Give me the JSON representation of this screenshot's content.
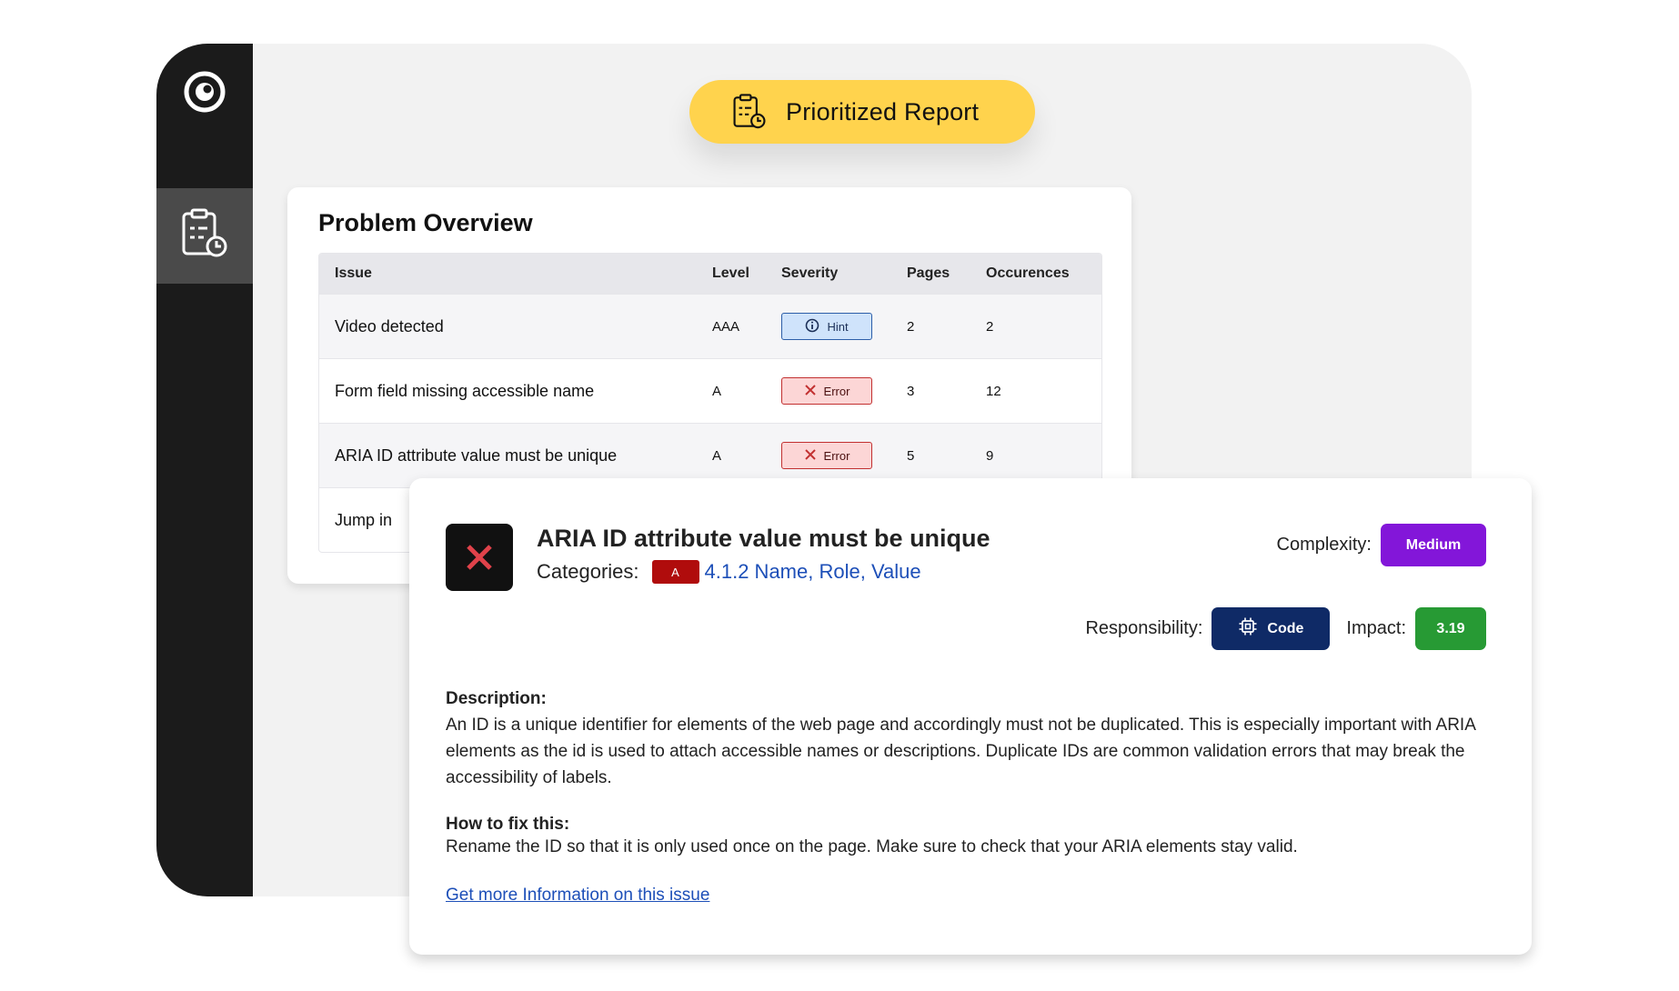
{
  "header": {
    "pill_label": "Prioritized Report"
  },
  "sidebar": {
    "items": [
      {
        "icon": "eye-logo-icon"
      },
      {
        "icon": "clipboard-clock-icon",
        "active": true
      }
    ]
  },
  "overview": {
    "title": "Problem Overview",
    "columns": {
      "issue": "Issue",
      "level": "Level",
      "severity": "Severity",
      "pages": "Pages",
      "occurrences": "Occurences"
    },
    "rows": [
      {
        "issue": "Video detected",
        "level": "AAA",
        "severity": "Hint",
        "pages": "2",
        "occurrences": "2"
      },
      {
        "issue": "Form field missing accessible name",
        "level": "A",
        "severity": "Error",
        "pages": "3",
        "occurrences": "12"
      },
      {
        "issue": "ARIA ID attribute value must be unique",
        "level": "A",
        "severity": "Error",
        "pages": "5",
        "occurrences": "9"
      },
      {
        "issue": "Jump in",
        "level": "",
        "severity": "",
        "pages": "",
        "occurrences": ""
      }
    ]
  },
  "detail": {
    "title": "ARIA ID attribute value must be unique",
    "categories_label": "Categories:",
    "level_badge": "A",
    "category_link": "4.1.2 Name, Role, Value",
    "complexity_label": "Complexity:",
    "complexity_value": "Medium",
    "responsibility_label": "Responsibility:",
    "responsibility_value": "Code",
    "impact_label": "Impact:",
    "impact_value": "3.19",
    "description_heading": "Description:",
    "description_text": "An ID is a unique identifier for elements of the web page and accordingly must not be duplicated. This is especially important with ARIA elements as the id is used to attach accessible names or descriptions. Duplicate IDs are common validation errors that may break the accessibility of labels.",
    "fix_heading": "How to fix this:",
    "fix_text": "Rename the ID so that it is only used once on the page. Make sure to check that your ARIA elements stay valid.",
    "more_link": "Get more Information on this issue"
  },
  "colors": {
    "pill": "#ffd34d",
    "sidebar": "#1b1b1b",
    "medium": "#8316d9",
    "code": "#0f2a66",
    "impact": "#279a34",
    "error": "#b00c0c",
    "link": "#1d4fb8"
  }
}
